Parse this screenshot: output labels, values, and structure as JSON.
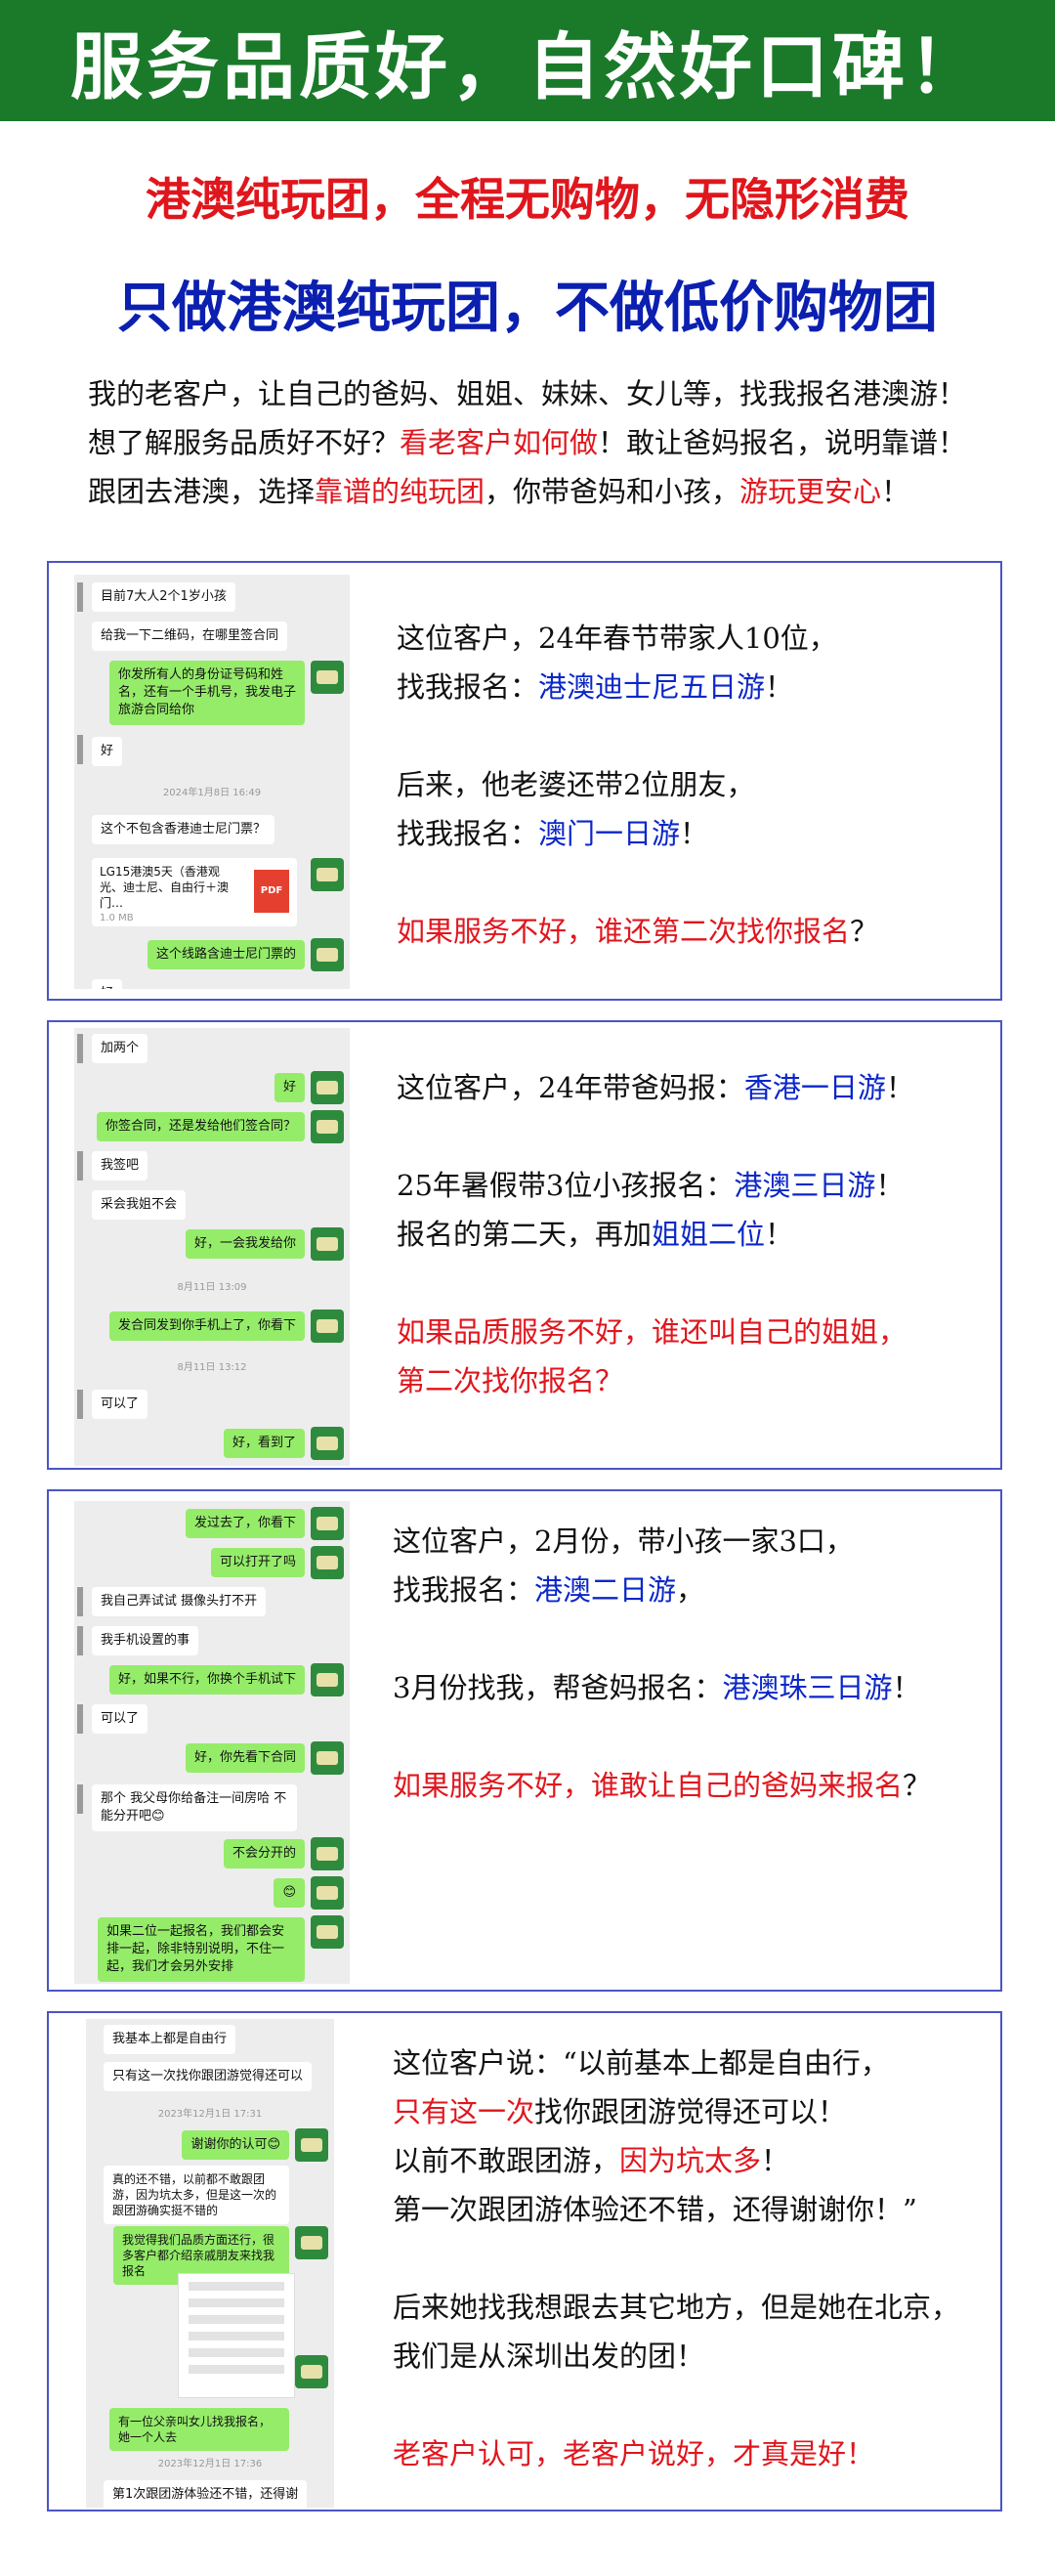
{
  "banner": {
    "title": "服务品质好，自然好口碑！"
  },
  "sub1": "港澳纯玩团，全程无购物，无隐形消费",
  "sub2": "只做港澳纯玩团，不做低价购物团",
  "intro": {
    "l1": "我的老客户，让自己的爸妈、姐姐、妹妹、女儿等，找我报名港澳游！",
    "l2a": "想了解服务品质好不好？",
    "l2b": "看老客户如何做",
    "l2c": "！敢让爸妈报名，说明靠谱！",
    "l3a": "跟团去港澳，选择",
    "l3b": "靠谱的纯玩团",
    "l3c": "，你带爸妈和小孩，",
    "l3d": "游玩更安心",
    "l3e": "！"
  },
  "card1": {
    "chat": {
      "m1": "目前7大人2个1岁小孩",
      "m2": "给我一下二维码，在哪里签合同",
      "m3": "你发所有人的身份证号码和姓名，还有一个手机号，我发电子旅游合同给你",
      "m4": "好",
      "t1": "2024年1月8日 16:49",
      "m5": "这个不包含香港迪士尼门票？",
      "file": "LG15港澳5天（香港观光、迪士尼、自由行＋澳门…",
      "file_size": "1.0 MB",
      "pdf": "PDF",
      "m6": "这个线路含迪士尼门票的",
      "m7": "好"
    },
    "l1": "这位客户，24年春节带家人10位，",
    "l2a": "找我报名：",
    "l2b": "港澳迪士尼五日游",
    "l2c": "！",
    "l3": "后来，他老婆还带2位朋友，",
    "l4a": "找我报名：",
    "l4b": "澳门一日游",
    "l4c": "！",
    "l5": "如果服务不好，谁还第二次找你报名",
    "l5b": "？"
  },
  "card2": {
    "chat": {
      "m1": "加两个",
      "m2": "好",
      "m3": "你签合同，还是发给他们签合同？",
      "m4": "我签吧",
      "m5": "采会我姐不会",
      "m6": "好，一会我发给你",
      "t1": "8月11日 13:09",
      "m7": "发合同发到你手机上了，你看下",
      "t2": "8月11日 13:12",
      "m8": "可以了",
      "m9": "好，看到了"
    },
    "l1a": "这位客户，24年带爸妈报：",
    "l1b": "香港一日游",
    "l1c": "！",
    "l2a": "25年暑假带3位小孩报名：",
    "l2b": "港澳三日游",
    "l2c": "！",
    "l3a": "报名的第二天，再加",
    "l3b": "姐姐二位",
    "l3c": "！",
    "l4": "如果品质服务不好，谁还叫自己的姐姐，",
    "l5": "第二次找你报名？"
  },
  "card3": {
    "chat": {
      "m1": "发过去了，你看下",
      "m2": "可以打开了吗",
      "m3": "我自己弄试试 摄像头打不开",
      "m4": "我手机设置的事",
      "m5": "好，如果不行，你换个手机试下",
      "m6": "可以了",
      "m7": "好，你先看下合同",
      "m8": "那个 我父母你给备注一间房哈 不能分开吧😊",
      "m9": "不会分开的",
      "m10": "😊",
      "m11": "如果二位一起报名，我们都会安排一起，除非特别说明，不住一起，我们才会另外安排"
    },
    "l1": "这位客户，2月份，带小孩一家3口，",
    "l2a": "找我报名：",
    "l2b": "港澳二日游",
    "l2c": "，",
    "l3a": "3月份找我，帮爸妈报名：",
    "l3b": "港澳珠三日游",
    "l3c": "！",
    "l4": "如果服务不好，谁敢让自己的爸妈来报名",
    "l4b": "？"
  },
  "card4": {
    "chat": {
      "m1": "我基本上都是自由行",
      "m2": "只有这一次找你跟团游觉得还可以",
      "t1": "2023年12月1日 17:31",
      "m3": "谢谢你的认可😊",
      "m4": "真的还不错，以前都不敢跟团游，因为坑太多，但是这一次的跟团游确实挺不错的",
      "m5": "我觉得我们品质方面还行，很多客户都介绍亲戚朋友来找我报名",
      "m6": "有一位父亲叫女儿找我报名，她一个人去",
      "t2": "2023年12月1日 17:36",
      "m7": "第1次跟团游体验还不错，还得谢"
    },
    "l1": "这位客户说：“以前基本上都是自由行，",
    "l2a": "只有这一次",
    "l2b": "找你跟团游觉得还可以！",
    "l3a": "以前不敢跟团游，",
    "l3b": "因为坑太多",
    "l3c": "！",
    "l4": "第一次跟团游体验还不错，还得谢谢你！”",
    "l5": "后来她找我想跟去其它地方，但是她在北京，",
    "l6": "我们是从深圳出发的团！",
    "l7": "老客户认可，老客户说好，才真是好！"
  }
}
